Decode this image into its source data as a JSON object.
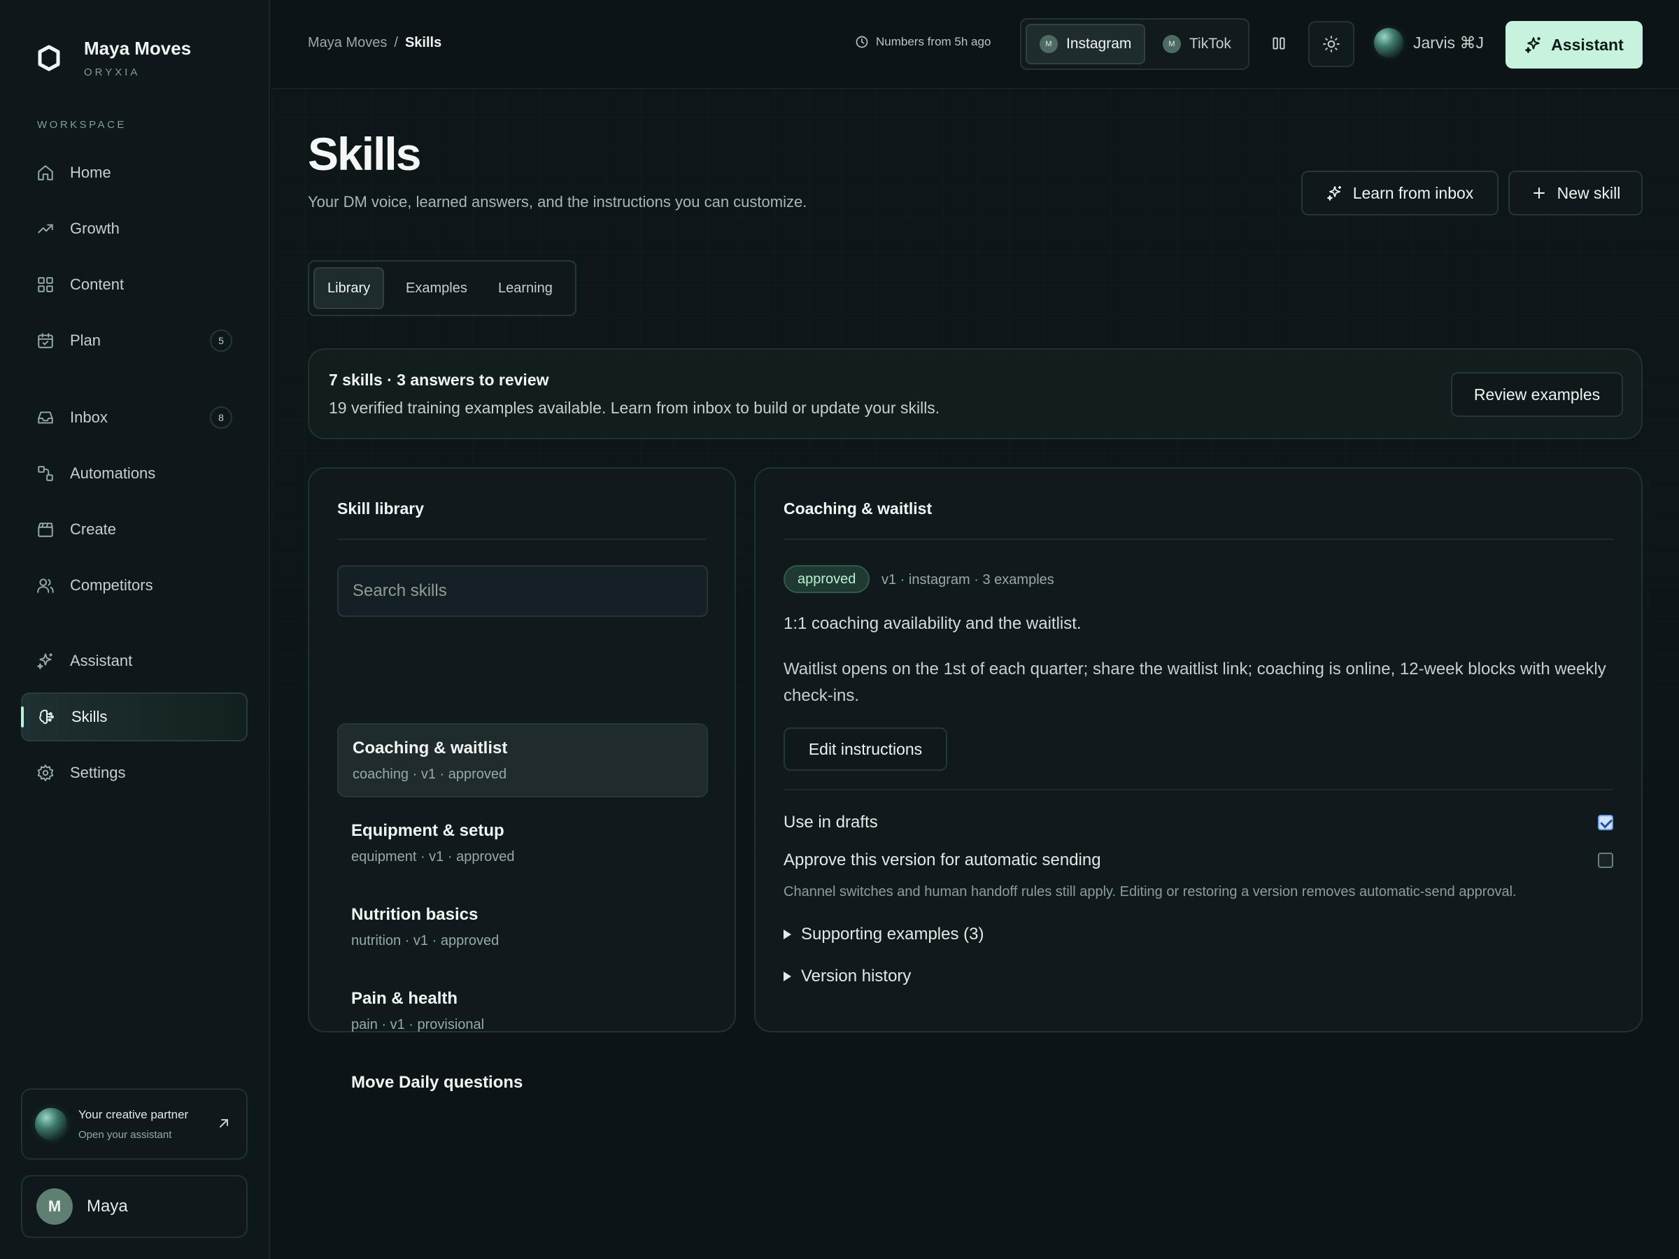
{
  "app": {
    "name": "Maya Moves",
    "org": "ORYXIA"
  },
  "sidebar": {
    "section_label": "WORKSPACE",
    "items": [
      {
        "label": "Home",
        "icon": "home-icon"
      },
      {
        "label": "Growth",
        "icon": "trend-icon"
      },
      {
        "label": "Content",
        "icon": "grid-icon"
      },
      {
        "label": "Plan",
        "icon": "calendar-icon",
        "count": "5"
      },
      {
        "label": "Inbox",
        "icon": "inbox-icon",
        "count": "8"
      },
      {
        "label": "Automations",
        "icon": "automation-icon"
      },
      {
        "label": "Create",
        "icon": "clapper-icon"
      },
      {
        "label": "Competitors",
        "icon": "users-icon"
      },
      {
        "label": "Assistant",
        "icon": "sparkle-icon"
      },
      {
        "label": "Skills",
        "icon": "brain-icon",
        "active": true
      },
      {
        "label": "Settings",
        "icon": "gear-icon"
      }
    ],
    "partner": {
      "title": "Your creative partner",
      "subtitle": "Open your assistant"
    },
    "user": {
      "initial": "M",
      "name": "Maya"
    }
  },
  "topbar": {
    "breadcrumb": {
      "parent": "Maya Moves",
      "separator": "/",
      "current": "Skills"
    },
    "freshness": "Numbers from 5h ago",
    "channels": [
      {
        "label": "Instagram",
        "avatar": "M",
        "active": true
      },
      {
        "label": "TikTok",
        "avatar": "M",
        "active": false
      }
    ],
    "jarvis_label": "Jarvis ⌘J",
    "assistant_label": "Assistant"
  },
  "page": {
    "title": "Skills",
    "subtitle": "Your DM voice, learned answers, and the instructions you can customize.",
    "learn_button": "Learn from inbox",
    "new_button": "New skill",
    "tabs": [
      {
        "label": "Library",
        "active": true
      },
      {
        "label": "Examples",
        "active": false
      },
      {
        "label": "Learning",
        "active": false
      }
    ]
  },
  "summary": {
    "title": "7 skills · 3 answers to review",
    "text": "19 verified training examples available. Learn from inbox to build or update your skills.",
    "review_button": "Review examples"
  },
  "library": {
    "heading": "Skill library",
    "search_placeholder": "Search skills",
    "skills": [
      {
        "name": "Coaching & waitlist",
        "meta": "coaching · v1 · approved",
        "active": true
      },
      {
        "name": "Equipment & setup",
        "meta": "equipment · v1 · approved"
      },
      {
        "name": "Nutrition basics",
        "meta": "nutrition · v1 · approved"
      },
      {
        "name": "Pain & health",
        "meta": "pain · v1 · provisional"
      },
      {
        "name": "Move Daily questions",
        "meta": ""
      }
    ]
  },
  "detail": {
    "heading": "Coaching & waitlist",
    "status": "approved",
    "meta": "v1 · instagram · 3 examples",
    "summary": "1:1 coaching availability and the waitlist.",
    "instructions": "Waitlist opens on the 1st of each quarter; share the waitlist link; coaching is online, 12-week blocks with weekly check-ins.",
    "edit_button": "Edit instructions",
    "use_in_drafts": {
      "label": "Use in drafts",
      "checked": true
    },
    "auto_send": {
      "label": "Approve this version for automatic sending",
      "checked": false
    },
    "note": "Channel switches and human handoff rules still apply. Editing or restoring a version removes automatic-send approval.",
    "supporting_examples": "Supporting examples (3)",
    "version_history": "Version history"
  },
  "colors": {
    "accent": "#c7f2dd",
    "background": "#0c1417",
    "card": "#101a1c",
    "badge_bg": "#1f3a32",
    "badge_text": "#b9f0d2"
  }
}
